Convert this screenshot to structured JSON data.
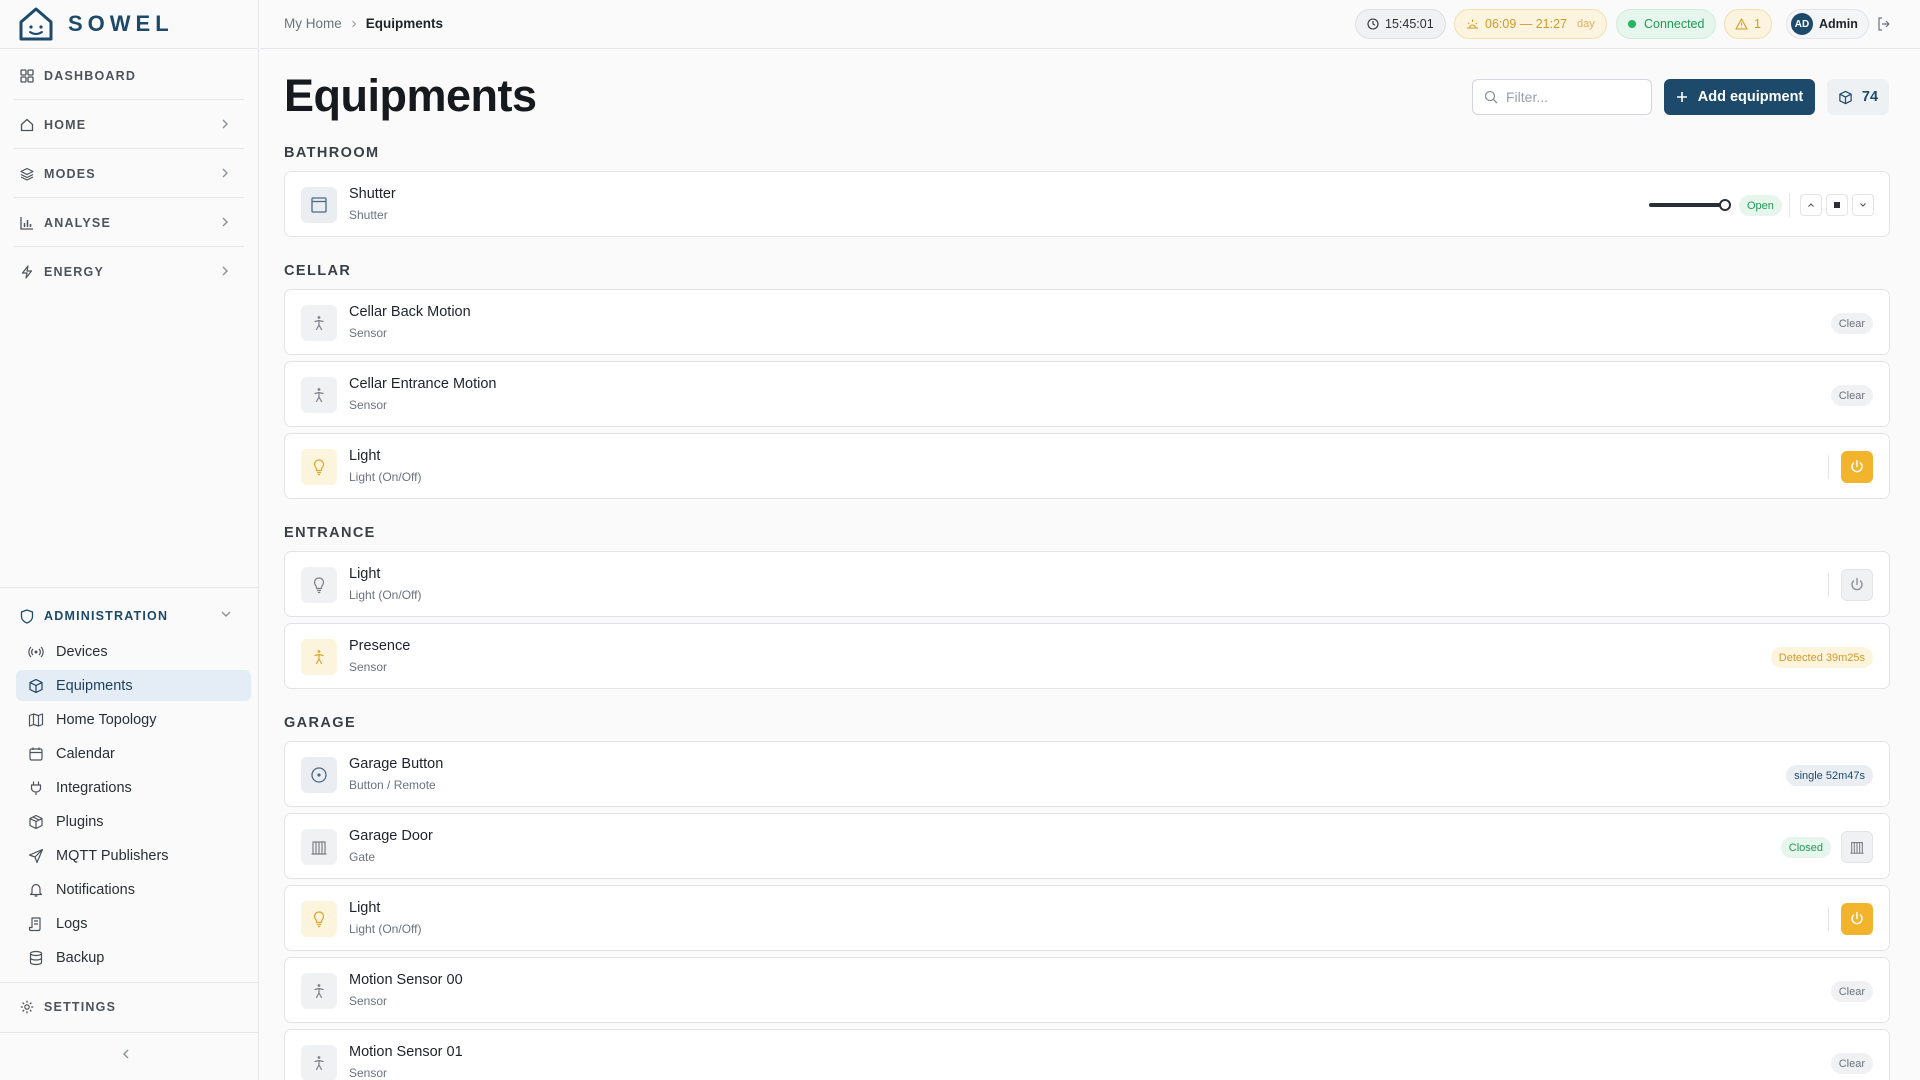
{
  "app": {
    "name": "SOWEL"
  },
  "nav": {
    "dashboard": "DASHBOARD",
    "home": "HOME",
    "modes": "MODES",
    "analyse": "ANALYSE",
    "energy": "ENERGY",
    "administration": "ADMINISTRATION",
    "settings": "SETTINGS",
    "admin_items": [
      "Devices",
      "Equipments",
      "Home Topology",
      "Calendar",
      "Integrations",
      "Plugins",
      "MQTT Publishers",
      "Notifications",
      "Logs",
      "Backup"
    ],
    "active_item": "Equipments"
  },
  "topbar": {
    "breadcrumb_home": "My Home",
    "breadcrumb_current": "Equipments",
    "time": "15:45:01",
    "sun_range": "06:09 — 21:27",
    "sun_phase": "day",
    "connection": "Connected",
    "alerts": "1",
    "user_initials": "AD",
    "user_name": "Admin"
  },
  "main": {
    "title": "Equipments",
    "filter_placeholder": "Filter...",
    "add_label": "Add equipment",
    "count": "74"
  },
  "sections": {
    "bathroom": "BATHROOM",
    "cellar": "CELLAR",
    "entrance": "ENTRANCE",
    "garage": "GARAGE"
  },
  "equipments": {
    "bathroom_shutter": {
      "name": "Shutter",
      "type": "Shutter",
      "status": "Open",
      "position_percent": 100
    },
    "cellar_back": {
      "name": "Cellar Back Motion",
      "type": "Sensor",
      "status": "Clear"
    },
    "cellar_entrance": {
      "name": "Cellar Entrance Motion",
      "type": "Sensor",
      "status": "Clear"
    },
    "cellar_light": {
      "name": "Light",
      "type": "Light (On/Off)",
      "state": "on"
    },
    "entrance_light": {
      "name": "Light",
      "type": "Light (On/Off)",
      "state": "off"
    },
    "entrance_presence": {
      "name": "Presence",
      "type": "Sensor",
      "status": "Detected 39m25s"
    },
    "garage_button": {
      "name": "Garage Button",
      "type": "Button / Remote",
      "status": "single 52m47s"
    },
    "garage_door": {
      "name": "Garage Door",
      "type": "Gate",
      "status": "Closed"
    },
    "garage_light": {
      "name": "Light",
      "type": "Light (On/Off)",
      "state": "on"
    },
    "motion_00": {
      "name": "Motion Sensor 00",
      "type": "Sensor",
      "status": "Clear"
    },
    "motion_01": {
      "name": "Motion Sensor 01",
      "type": "Sensor",
      "status": "Clear"
    }
  },
  "colors": {
    "brand": "#1d4a6a",
    "on": "#f2b42c",
    "success": "#1f9a55",
    "warning": "#d09a24"
  }
}
